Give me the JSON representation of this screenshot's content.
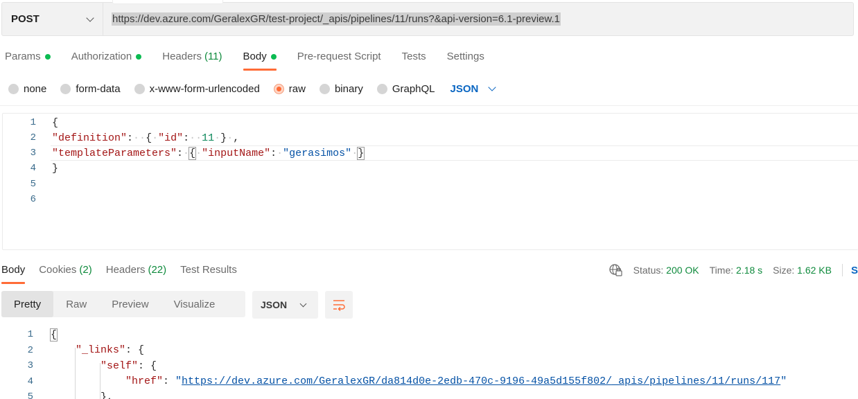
{
  "request": {
    "method": "POST",
    "url": "https://dev.azure.com/GeralexGR/test-project/_apis/pipelines/11/runs?&api-version=6.1-preview.1"
  },
  "request_tabs": [
    {
      "label": "Params",
      "dot": true
    },
    {
      "label": "Authorization",
      "dot": true
    },
    {
      "label": "Headers",
      "count": "(11)"
    },
    {
      "label": "Body",
      "dot": true,
      "active": true
    },
    {
      "label": "Pre-request Script"
    },
    {
      "label": "Tests"
    },
    {
      "label": "Settings"
    }
  ],
  "body_types": [
    {
      "label": "none"
    },
    {
      "label": "form-data"
    },
    {
      "label": "x-www-form-urlencoded"
    },
    {
      "label": "raw",
      "selected": true
    },
    {
      "label": "binary"
    },
    {
      "label": "GraphQL"
    }
  ],
  "body_format": "JSON",
  "request_body_lines": [
    "1",
    "2",
    "3",
    "4",
    "5",
    "6"
  ],
  "request_body": {
    "open_brace": "{",
    "close_brace": "}",
    "key_definition": "\"definition\"",
    "key_id": "\"id\"",
    "value_id": "11",
    "key_template": "\"templateParameters\"",
    "key_input": "\"inputName\"",
    "value_input": "\"gerasimos\""
  },
  "response_tabs": [
    {
      "label": "Body",
      "active": true
    },
    {
      "label": "Cookies",
      "count": "(2)"
    },
    {
      "label": "Headers",
      "count": "(22)"
    },
    {
      "label": "Test Results"
    }
  ],
  "status": {
    "status_label": "Status:",
    "status_value": "200 OK",
    "time_label": "Time:",
    "time_value": "2.18 s",
    "size_label": "Size:",
    "size_value": "1.62 KB",
    "save_label": "S"
  },
  "view_modes": [
    "Pretty",
    "Raw",
    "Preview",
    "Visualize"
  ],
  "response_format": "JSON",
  "icons": {
    "globe": "globe-network-icon",
    "wrap": "wrap-lines-icon"
  },
  "colors": {
    "accent": "#ff6c37",
    "success": "#0cbb52",
    "link": "#0a66c2"
  },
  "response_body_lines": [
    "1",
    "2",
    "3",
    "4",
    "5"
  ],
  "response_body": {
    "open_brace": "{",
    "key_links": "\"_links\"",
    "key_self": "\"self\"",
    "key_href": "\"href\"",
    "href_value": "https://dev.azure.com/GeralexGR/da814d0e-2edb-470c-9196-49a5d155f802/_apis/pipelines/11/runs/117",
    "close_brace": "},"
  }
}
